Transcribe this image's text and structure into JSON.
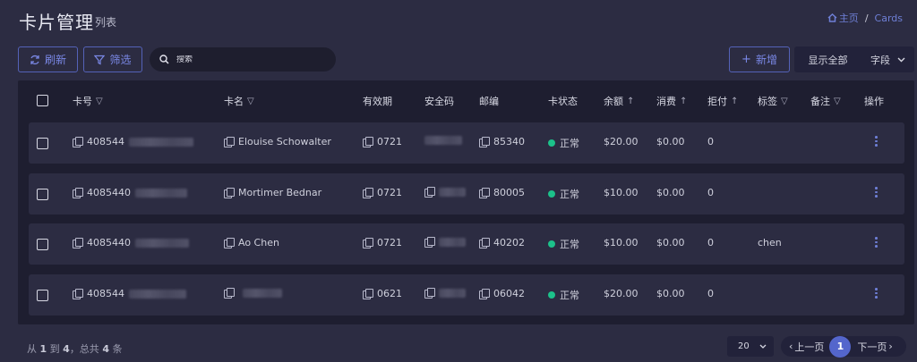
{
  "header": {
    "title": "卡片管理",
    "subtitle": "列表"
  },
  "breadcrumb": {
    "home_label": "主页",
    "separator": "/",
    "current": "Cards"
  },
  "toolbar": {
    "refresh_label": "刷新",
    "filter_label": "筛选",
    "search_placeholder": "搜索",
    "add_label": "新增",
    "show_all_label": "显示全部",
    "fields_label": "字段"
  },
  "table": {
    "columns": {
      "card_no": "卡号",
      "card_name": "卡名",
      "expiry": "有效期",
      "cvv": "安全码",
      "zip": "邮编",
      "status": "卡状态",
      "balance": "余额",
      "spend": "消费",
      "declined": "拒付",
      "tags": "标签",
      "notes": "备注",
      "actions": "操作"
    },
    "rows": [
      {
        "card_no": "408544",
        "card_name": "Elouise Schowalter",
        "expiry": "0721",
        "zip": "85340",
        "status": "正常",
        "balance": "$20.00",
        "spend": "$0.00",
        "declined": "0",
        "tags": ""
      },
      {
        "card_no": "4085440",
        "card_name": "Mortimer Bednar",
        "expiry": "0721",
        "zip": "80005",
        "status": "正常",
        "balance": "$10.00",
        "spend": "$0.00",
        "declined": "0",
        "tags": ""
      },
      {
        "card_no": "4085440",
        "card_name": "Ao Chen",
        "expiry": "0721",
        "zip": "40202",
        "status": "正常",
        "balance": "$10.00",
        "spend": "$0.00",
        "declined": "0",
        "tags": "chen"
      },
      {
        "card_no": "408544",
        "card_name": "",
        "expiry": "0621",
        "zip": "06042",
        "status": "正常",
        "balance": "$20.00",
        "spend": "$0.00",
        "declined": "0",
        "tags": ""
      }
    ]
  },
  "footer": {
    "summary_prefix": "从",
    "from": "1",
    "to_word": "到",
    "to": "4",
    "total_prefix": "，总共",
    "total": "4",
    "unit": "条",
    "page_size": "20",
    "prev_label": "上一页",
    "current_page": "1",
    "next_label": "下一页"
  },
  "colors": {
    "accent": "#5466cc",
    "status_ok": "#1cc18a",
    "background": "#2c2c42"
  },
  "icons": [
    "home-icon",
    "refresh-icon",
    "filter-icon",
    "search-icon",
    "plus-icon",
    "chevron-down-icon",
    "copy-icon",
    "kebab-icon"
  ]
}
